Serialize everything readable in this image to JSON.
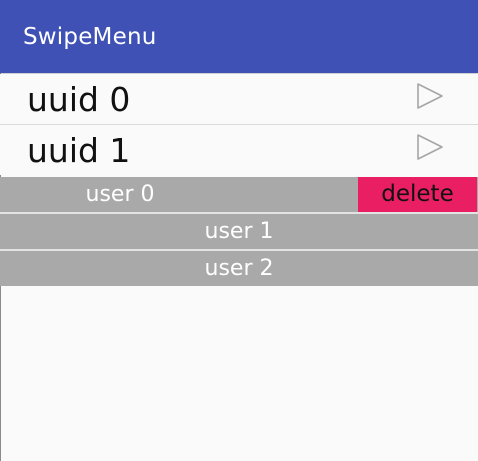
{
  "app_bar": {
    "title": "SwipeMenu",
    "color": "#3f51b5"
  },
  "list": {
    "items": [
      {
        "label": "uuid 0",
        "icon": "play-icon"
      },
      {
        "label": "uuid 1",
        "icon": "play-icon"
      }
    ]
  },
  "swipe_list": {
    "rows": [
      {
        "label": "user 0",
        "action_label": "delete"
      },
      {
        "label": "user 1"
      },
      {
        "label": "user 2"
      }
    ],
    "row_color": "#a9a9a9",
    "action_color": "#e91e63"
  }
}
